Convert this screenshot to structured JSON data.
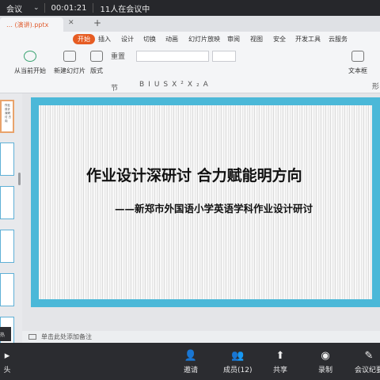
{
  "meeting_top": {
    "app_name": "会议",
    "timer": "00:01:21",
    "participants_status": "11人在会议中"
  },
  "wps": {
    "doc_tab": "… (演讲).pptx",
    "menu": [
      "开始",
      "插入",
      "设计",
      "切换",
      "动画",
      "幻灯片放映",
      "审阅",
      "视图",
      "安全",
      "开发工具",
      "云服务"
    ],
    "active_menu": "开始",
    "tools": {
      "play_from_current": "从当前开始",
      "new_slide": "新建幻灯片",
      "layout": "版式",
      "section": "节",
      "reset": "重置",
      "textbox": "文本框",
      "shape": "形"
    },
    "format_glyphs": "BIUSX²X₂A",
    "notes_placeholder": "单击此处添加备注",
    "left_tag": "热"
  },
  "slide": {
    "title": "作业设计深研讨  合力赋能明方向",
    "subtitle": "——新郑市外国语小学英语学科作业设计研讨",
    "thumb_text": "作业设计\n深研讨\n方向",
    "border_color": "#4bb8d8"
  },
  "meeting_bottom": {
    "camera": "头",
    "invite": "邀请",
    "members": "成员(12)",
    "share": "共享",
    "record": "录制",
    "minutes": "会议纪要"
  }
}
